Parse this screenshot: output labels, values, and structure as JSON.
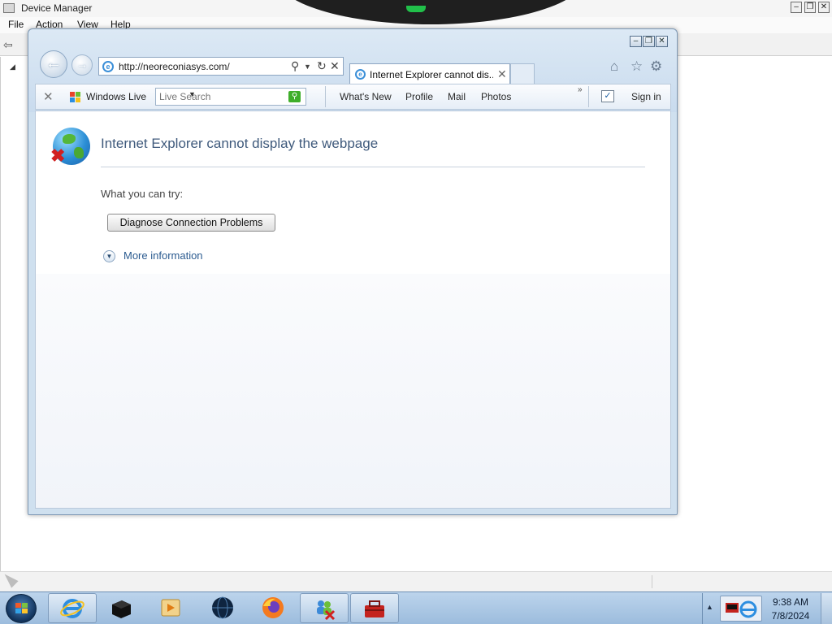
{
  "device_manager": {
    "title": "Device Manager",
    "menu": [
      "File",
      "Action",
      "View",
      "Help"
    ],
    "controls": {
      "minimize": "–",
      "restore": "❐",
      "close": "✕"
    }
  },
  "ie": {
    "controls": {
      "minimize": "–",
      "restore": "❐",
      "close": "✕"
    },
    "address": {
      "url": "http://neoreconiasys.com/"
    },
    "tab": {
      "title": "Internet Explorer cannot dis..."
    },
    "right_icons": [
      "home-icon",
      "favorites-star-icon",
      "tools-gear-icon"
    ],
    "toolbar": {
      "brand": "Windows Live",
      "search_placeholder": "Live Search",
      "links": [
        "What's New",
        "Profile",
        "Mail",
        "Photos"
      ],
      "sign_in": "Sign in"
    },
    "error_page": {
      "heading": "Internet Explorer cannot display the webpage",
      "try_text": "What you can try:",
      "diagnose_button": "Diagnose Connection Problems",
      "more_info": "More information"
    }
  },
  "taskbar": {
    "items": [
      "internet-explorer",
      "black-box-app",
      "media-player",
      "dark-globe-app",
      "firefox",
      "network-users",
      "toolbox-app"
    ],
    "clock": {
      "time": "9:38 AM",
      "date": "7/8/2024"
    }
  }
}
